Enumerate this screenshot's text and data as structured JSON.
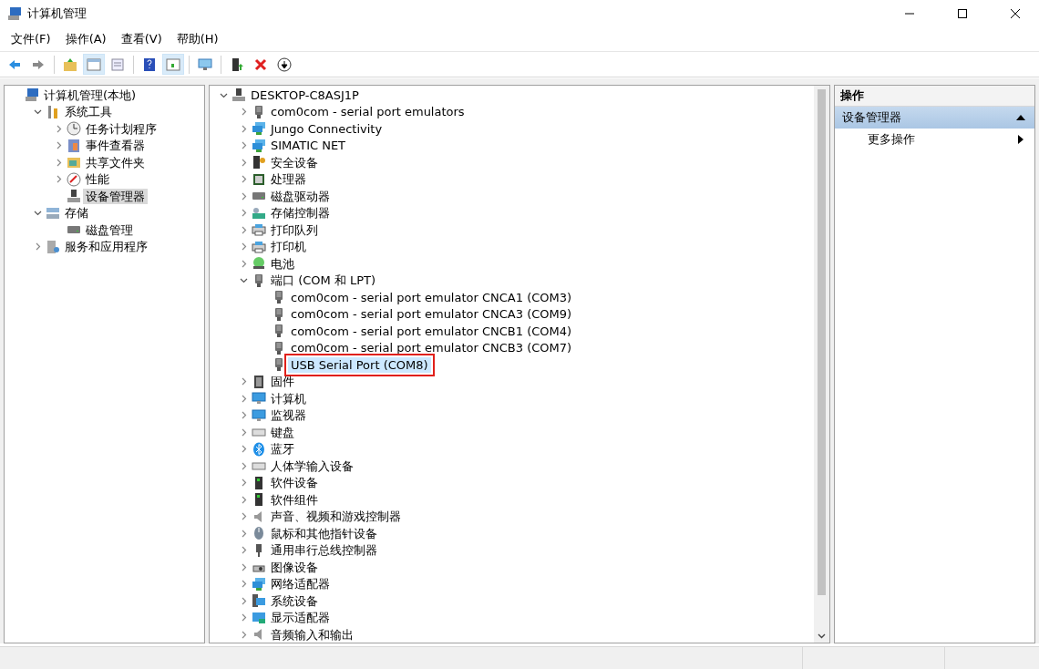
{
  "window": {
    "title": "计算机管理"
  },
  "menu": [
    {
      "label": "文件(F)"
    },
    {
      "label": "操作(A)"
    },
    {
      "label": "查看(V)"
    },
    {
      "label": "帮助(H)"
    }
  ],
  "toolbar": [
    {
      "selected": false
    },
    {
      "selected": false
    },
    {
      "selected": false
    },
    {
      "selected": true
    },
    {
      "selected": false
    },
    {
      "selected": false
    },
    {
      "selected": true
    },
    {
      "selected": false
    },
    {
      "selected": false
    },
    {
      "selected": false
    },
    {
      "selected": false
    }
  ],
  "nav_tree": [
    {
      "label": "计算机管理(本地)",
      "selected": false,
      "children": [
        {
          "label": "系统工具",
          "expanded": true,
          "selected": false,
          "children": [
            {
              "label": "任务计划程序",
              "expanded": false,
              "selected": false
            },
            {
              "label": "事件查看器",
              "expanded": false,
              "selected": false
            },
            {
              "label": "共享文件夹",
              "expanded": false,
              "selected": false
            },
            {
              "label": "性能",
              "expanded": false,
              "selected": false
            },
            {
              "label": "设备管理器",
              "selected": true
            }
          ]
        },
        {
          "label": "存储",
          "expanded": true,
          "selected": false,
          "children": [
            {
              "label": "磁盘管理",
              "selected": false
            }
          ]
        },
        {
          "label": "服务和应用程序",
          "expanded": false,
          "selected": false
        }
      ]
    }
  ],
  "device_tree": [
    {
      "label": "DESKTOP-C8ASJ1P",
      "expanded": true,
      "selected": false,
      "highlighted": false,
      "children": [
        {
          "label": "com0com - serial port emulators",
          "expanded": false,
          "selected": false,
          "highlighted": false
        },
        {
          "label": "Jungo Connectivity",
          "expanded": false,
          "selected": false,
          "highlighted": false
        },
        {
          "label": "SIMATIC NET",
          "expanded": false,
          "selected": false,
          "highlighted": false
        },
        {
          "label": "安全设备",
          "expanded": false,
          "selected": false,
          "highlighted": false
        },
        {
          "label": "处理器",
          "expanded": false,
          "selected": false,
          "highlighted": false
        },
        {
          "label": "磁盘驱动器",
          "expanded": false,
          "selected": false,
          "highlighted": false
        },
        {
          "label": "存储控制器",
          "expanded": false,
          "selected": false,
          "highlighted": false
        },
        {
          "label": "打印队列",
          "expanded": false,
          "selected": false,
          "highlighted": false
        },
        {
          "label": "打印机",
          "expanded": false,
          "selected": false,
          "highlighted": false
        },
        {
          "label": "电池",
          "expanded": false,
          "selected": false,
          "highlighted": false
        },
        {
          "label": "端口 (COM 和 LPT)",
          "expanded": true,
          "selected": false,
          "highlighted": false,
          "children": [
            {
              "label": "com0com - serial port emulator CNCA1 (COM3)",
              "selected": false,
              "highlighted": false
            },
            {
              "label": "com0com - serial port emulator CNCA3 (COM9)",
              "selected": false,
              "highlighted": false
            },
            {
              "label": "com0com - serial port emulator CNCB1 (COM4)",
              "selected": false,
              "highlighted": false
            },
            {
              "label": "com0com - serial port emulator CNCB3 (COM7)",
              "selected": false,
              "highlighted": false
            },
            {
              "label": "USB Serial Port (COM8)",
              "selected": true,
              "highlighted": true
            }
          ]
        },
        {
          "label": "固件",
          "expanded": false,
          "selected": false,
          "highlighted": false
        },
        {
          "label": "计算机",
          "expanded": false,
          "selected": false,
          "highlighted": false
        },
        {
          "label": "监视器",
          "expanded": false,
          "selected": false,
          "highlighted": false
        },
        {
          "label": "键盘",
          "expanded": false,
          "selected": false,
          "highlighted": false
        },
        {
          "label": "蓝牙",
          "expanded": false,
          "selected": false,
          "highlighted": false
        },
        {
          "label": "人体学输入设备",
          "expanded": false,
          "selected": false,
          "highlighted": false
        },
        {
          "label": "软件设备",
          "expanded": false,
          "selected": false,
          "highlighted": false
        },
        {
          "label": "软件组件",
          "expanded": false,
          "selected": false,
          "highlighted": false
        },
        {
          "label": "声音、视频和游戏控制器",
          "expanded": false,
          "selected": false,
          "highlighted": false
        },
        {
          "label": "鼠标和其他指针设备",
          "expanded": false,
          "selected": false,
          "highlighted": false
        },
        {
          "label": "通用串行总线控制器",
          "expanded": false,
          "selected": false,
          "highlighted": false
        },
        {
          "label": "图像设备",
          "expanded": false,
          "selected": false,
          "highlighted": false
        },
        {
          "label": "网络适配器",
          "expanded": false,
          "selected": false,
          "highlighted": false
        },
        {
          "label": "系统设备",
          "expanded": false,
          "selected": false,
          "highlighted": false
        },
        {
          "label": "显示适配器",
          "expanded": false,
          "selected": false,
          "highlighted": false
        },
        {
          "label": "音频输入和输出",
          "expanded": false,
          "selected": false,
          "highlighted": false
        }
      ]
    }
  ],
  "actions": {
    "header": "操作",
    "sections": [
      {
        "title": "设备管理器",
        "expanded": true,
        "items": [
          {
            "label": "更多操作"
          }
        ]
      }
    ]
  }
}
